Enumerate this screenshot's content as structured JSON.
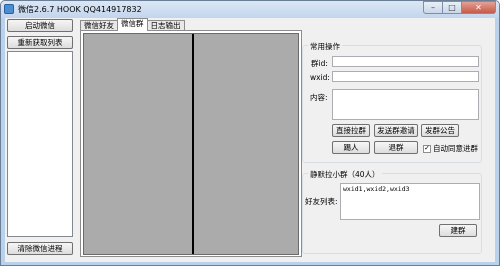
{
  "window": {
    "title": "微信2.6.7 HOOK QQ414917832",
    "minimize_glyph": "–",
    "maximize_glyph": "□",
    "close_glyph": "✕"
  },
  "left_panel": {
    "start_button": "启动微信",
    "refresh_button": "重新获取列表",
    "clear_button": "清除微信进程"
  },
  "tabs": [
    {
      "label": "微信好友"
    },
    {
      "label": "微信群"
    },
    {
      "label": "日志输出"
    }
  ],
  "active_tab": "微信群",
  "common_ops": {
    "legend": "常用操作",
    "group_id_label": "群id:",
    "wxid_label": "wxid:",
    "content_label": "内容:",
    "group_id_value": "",
    "wxid_value": "",
    "content_value": "",
    "pull_button": "直接拉群",
    "invite_button": "发送群邀请",
    "announce_button": "发群公告",
    "kick_button": "踢人",
    "quit_button": "退群",
    "auto_accept_label": "自动同意进群",
    "auto_accept_checked": true
  },
  "silent_pull": {
    "legend": "静默拉小群（40人）",
    "friends_label": "好友列表:",
    "friends_value": "wxid1,wxid2,wxid3",
    "create_button": "建群"
  }
}
